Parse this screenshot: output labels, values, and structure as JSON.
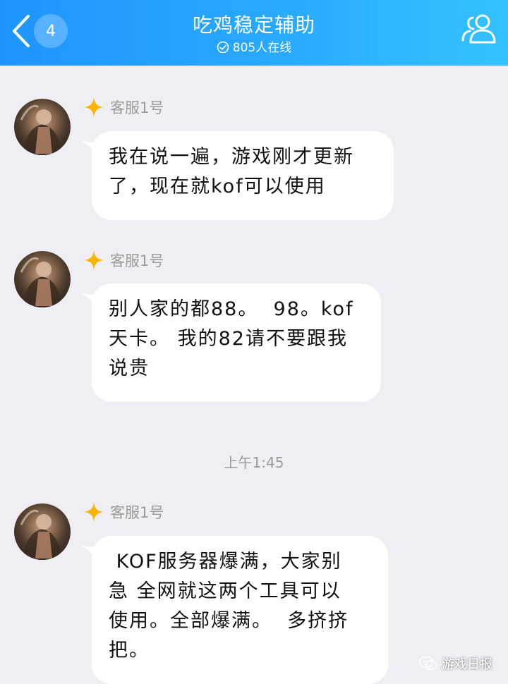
{
  "header": {
    "back_badge": "4",
    "title": "吃鸡稳定辅助",
    "online_text": "805人在线"
  },
  "messages": [
    {
      "sender": "客服1号",
      "text": "我在说一遍，游戏刚才更新\n了，现在就kof可以使用"
    },
    {
      "sender": "客服1号",
      "text": "别人家的都88。  98。kof\n天卡。 我的82请不要跟我\n说贵"
    },
    {
      "sender": "客服1号",
      "text": " KOF服务器爆满，大家别\n急 全网就这两个工具可以\n使用。全部爆满。  多挤挤\n把。"
    }
  ],
  "timestamp": "上午1:45",
  "watermark": "游戏日报",
  "colors": {
    "header_start": "#1f94ff",
    "header_end": "#33c2ff",
    "background": "#eeeef3",
    "diamond": "#f7b500",
    "name_text": "#9b9b9b"
  },
  "icons": {
    "back": "chevron-left-icon",
    "online": "check-circle-icon",
    "members": "group-members-icon",
    "rank": "diamond-star-icon"
  }
}
